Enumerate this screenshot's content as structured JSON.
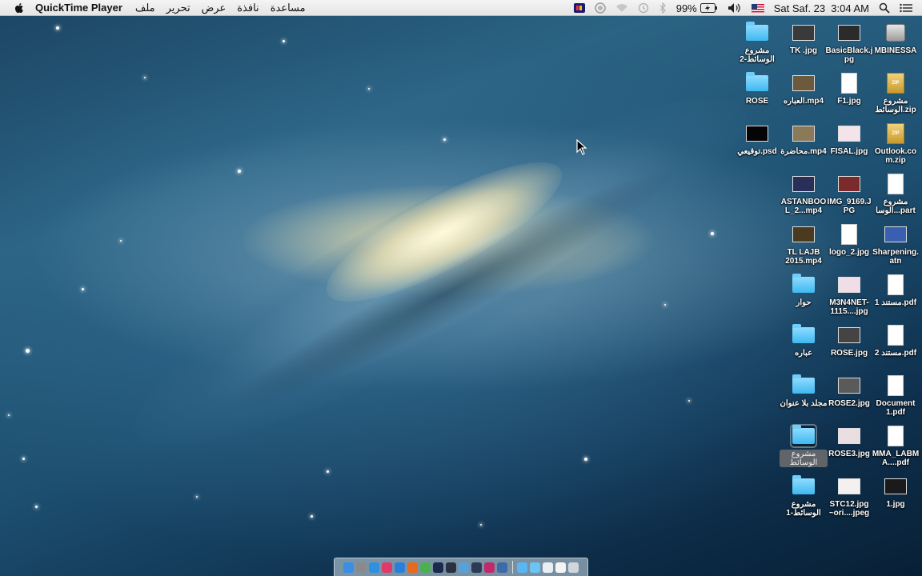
{
  "menubar": {
    "apple_icon": "apple-logo-icon",
    "app_name": "QuickTime Player",
    "menus": [
      "ملف",
      "تحرير",
      "عرض",
      "نافذة",
      "مساعدة"
    ],
    "battery_percent": "99%",
    "datetime": "Sat Saf. 23  3:04 AM",
    "status_icons": [
      "color-palette-icon",
      "screen-record-icon",
      "wifi-icon",
      "time-machine-icon",
      "bluetooth-icon",
      "battery-charging-icon",
      "volume-icon",
      "us-flag-input-icon",
      "spotlight-search-icon",
      "notification-center-icon"
    ]
  },
  "desktop": {
    "icons": [
      {
        "label": "مشروع الوسائط-2",
        "kind": "folder"
      },
      {
        "label": "TK .jpg",
        "kind": "photo",
        "color": "#3a3a3a"
      },
      {
        "label": "BasicBlack.jpg",
        "kind": "photo",
        "color": "#2b2b2b"
      },
      {
        "label": "MBINESSA",
        "kind": "disk"
      },
      {
        "label": "ROSE",
        "kind": "folder"
      },
      {
        "label": "العباره.mp4",
        "kind": "photo",
        "color": "#6b5a3c"
      },
      {
        "label": "F1.jpg",
        "kind": "doc"
      },
      {
        "label": "مشروع الوسائط.zip",
        "kind": "zip"
      },
      {
        "label": "توقيعي.psd",
        "kind": "photo",
        "color": "#050505"
      },
      {
        "label": "محاضرة.mp4",
        "kind": "photo",
        "color": "#8a7a5a"
      },
      {
        "label": "FISAL.jpg",
        "kind": "photo",
        "color": "#f2e4ea"
      },
      {
        "label": "Outlook.com.zip",
        "kind": "zip"
      },
      {
        "label": "ASTANBOOL_2...mp4",
        "kind": "photo",
        "color": "#2a2f5a"
      },
      {
        "label": "IMG_9169.JPG",
        "kind": "photo",
        "color": "#7a2a2a"
      },
      {
        "label": "مشروع الوسا...part",
        "kind": "doc"
      },
      {
        "label": "TL LAJB 2015.mp4",
        "kind": "photo",
        "color": "#4a3a20"
      },
      {
        "label": "logo_2.jpg",
        "kind": "doc"
      },
      {
        "label": "Sharpening.atn",
        "kind": "photo",
        "color": "#3b5fb0"
      },
      {
        "label": "حوار",
        "kind": "folder"
      },
      {
        "label": "M3N4NET-1115....jpg",
        "kind": "photo",
        "color": "#f0dde6"
      },
      {
        "label": "مستند 1.pdf",
        "kind": "doc"
      },
      {
        "label": "عباره",
        "kind": "folder"
      },
      {
        "label": "ROSE.jpg",
        "kind": "photo",
        "color": "#444444"
      },
      {
        "label": "مستند 2.pdf",
        "kind": "doc"
      },
      {
        "label": "مجلد بلا عنوان",
        "kind": "folder"
      },
      {
        "label": "ROSE2.jpg",
        "kind": "photo",
        "color": "#5a5a5a"
      },
      {
        "label": "Document 1.pdf",
        "kind": "doc"
      },
      {
        "label": "مشروع الوسائط",
        "kind": "folder",
        "selected": true
      },
      {
        "label": "ROSE3.jpg",
        "kind": "photo",
        "color": "#e9dfe0"
      },
      {
        "label": "MMA_LABMA....pdf",
        "kind": "doc"
      },
      {
        "label": "مشروع الوسائط-1",
        "kind": "folder"
      },
      {
        "label": "STC12.jpg ~ori....jpeg",
        "kind": "photo",
        "color": "#f4f0f0"
      },
      {
        "label": "1.jpg",
        "kind": "photo",
        "color": "#1a1a1a"
      }
    ]
  },
  "dock": {
    "apps": [
      {
        "name": "finder",
        "color": "#3a8ee6"
      },
      {
        "name": "launchpad",
        "color": "#8a8a8a"
      },
      {
        "name": "safari",
        "color": "#2f8fe0"
      },
      {
        "name": "itunes",
        "color": "#e03a6a"
      },
      {
        "name": "app-store",
        "color": "#2a7fd8"
      },
      {
        "name": "firefox",
        "color": "#e86a1e"
      },
      {
        "name": "chrome",
        "color": "#4caf50"
      },
      {
        "name": "photoshop",
        "color": "#1b2a4a"
      },
      {
        "name": "lightroom",
        "color": "#2a3240"
      },
      {
        "name": "preview",
        "color": "#5aa0d8"
      },
      {
        "name": "quicktime",
        "color": "#2c3a55"
      },
      {
        "name": "photo-booth",
        "color": "#c02a6a"
      },
      {
        "name": "iphoto",
        "color": "#3b6ba8"
      }
    ],
    "stacks": [
      {
        "name": "applications-stack",
        "color": "#5ab6f0"
      },
      {
        "name": "documents-stack",
        "color": "#6cc4f5"
      },
      {
        "name": "downloads-stack",
        "color": "#e8eef2"
      },
      {
        "name": "screen-stack",
        "color": "#f4f4f4"
      },
      {
        "name": "trash",
        "color": "#cfd6dc"
      }
    ]
  }
}
